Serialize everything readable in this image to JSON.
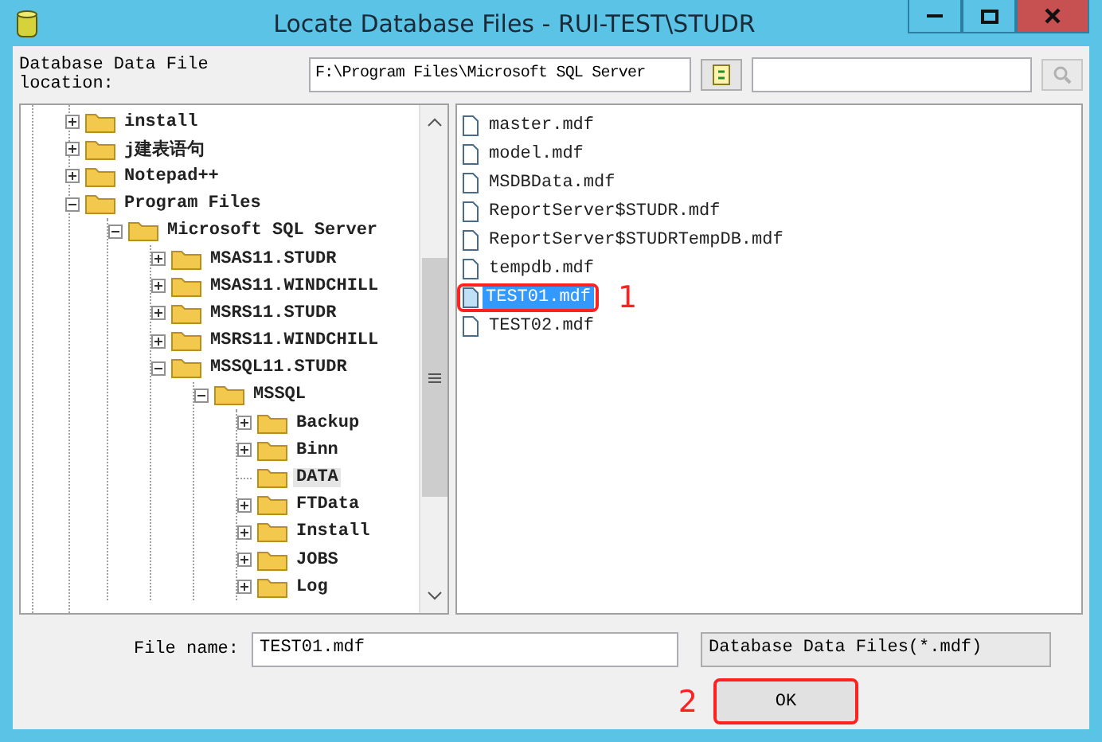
{
  "window": {
    "title": "Locate Database Files - RUI-TEST\\STUDR"
  },
  "location": {
    "label": "Database Data File location:",
    "value": "F:\\Program Files\\Microsoft SQL Server"
  },
  "tree": [
    {
      "label": "install",
      "expanded": false,
      "selected": false
    },
    {
      "label": "j建表语句",
      "expanded": false,
      "selected": false
    },
    {
      "label": "Notepad++",
      "expanded": false,
      "selected": false
    },
    {
      "label": "Program Files",
      "expanded": true,
      "selected": false,
      "children": [
        {
          "label": "Microsoft SQL Server",
          "expanded": true,
          "selected": false,
          "children": [
            {
              "label": "MSAS11.STUDR",
              "expanded": false,
              "selected": false
            },
            {
              "label": "MSAS11.WINDCHILL",
              "expanded": false,
              "selected": false
            },
            {
              "label": "MSRS11.STUDR",
              "expanded": false,
              "selected": false
            },
            {
              "label": "MSRS11.WINDCHILL",
              "expanded": false,
              "selected": false
            },
            {
              "label": "MSSQL11.STUDR",
              "expanded": true,
              "selected": false,
              "children": [
                {
                  "label": "MSSQL",
                  "expanded": true,
                  "selected": false,
                  "children": [
                    {
                      "label": "Backup",
                      "expanded": false,
                      "selected": false
                    },
                    {
                      "label": "Binn",
                      "expanded": false,
                      "selected": false
                    },
                    {
                      "label": "DATA",
                      "kind": "leaf",
                      "selected": true
                    },
                    {
                      "label": "FTData",
                      "expanded": false,
                      "selected": false
                    },
                    {
                      "label": "Install",
                      "expanded": false,
                      "selected": false
                    },
                    {
                      "label": "JOBS",
                      "expanded": false,
                      "selected": false
                    },
                    {
                      "label": "Log",
                      "expanded": false,
                      "selected": false
                    }
                  ]
                }
              ]
            }
          ]
        }
      ]
    }
  ],
  "files": [
    {
      "name": "master.mdf",
      "selected": false
    },
    {
      "name": "model.mdf",
      "selected": false
    },
    {
      "name": "MSDBData.mdf",
      "selected": false
    },
    {
      "name": "ReportServer$STUDR.mdf",
      "selected": false
    },
    {
      "name": "ReportServer$STUDRTempDB.mdf",
      "selected": false
    },
    {
      "name": "tempdb.mdf",
      "selected": false
    },
    {
      "name": "TEST01.mdf",
      "selected": true,
      "annotation": "1"
    },
    {
      "name": "TEST02.mdf",
      "selected": false
    }
  ],
  "file_name": {
    "label": "File name:",
    "value": "TEST01.mdf"
  },
  "file_type": {
    "value": "Database Data Files(*.mdf)"
  },
  "ok_button": {
    "label": "OK",
    "annotation": "2"
  }
}
